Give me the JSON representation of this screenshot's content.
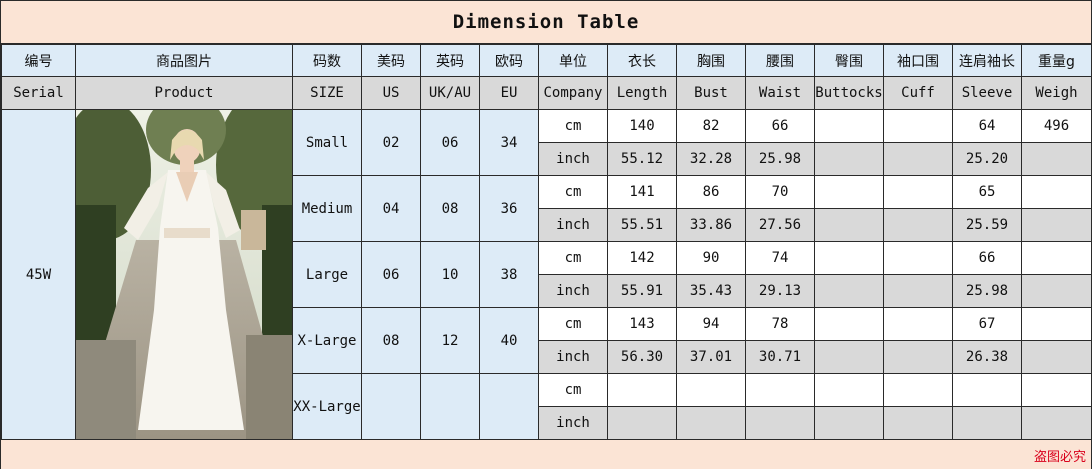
{
  "title": "Dimension Table",
  "header_cn": [
    "编号",
    "商品图片",
    "码数",
    "美码",
    "英码",
    "欧码",
    "单位",
    "衣长",
    "胸围",
    "腰围",
    "臀围",
    "袖口围",
    "连肩袖长",
    "重量g"
  ],
  "header_en": [
    "Serial",
    "Product",
    "SIZE",
    "US",
    "UK/AU",
    "EU",
    "Company",
    "Length",
    "Bust",
    "Waist",
    "Buttocks",
    "Cuff",
    "Sleeve",
    "Weigh"
  ],
  "serial": "45W",
  "product_image": "woman-in-white-long-sleeve-dress-photo",
  "sizes": [
    {
      "name": "Small",
      "us": "02",
      "uk": "06",
      "eu": "34",
      "cm": {
        "unit": "cm",
        "length": "140",
        "bust": "82",
        "waist": "66",
        "buttocks": "",
        "cuff": "",
        "sleeve": "64",
        "weight": "496"
      },
      "inch": {
        "unit": "inch",
        "length": "55.12",
        "bust": "32.28",
        "waist": "25.98",
        "buttocks": "",
        "cuff": "",
        "sleeve": "25.20",
        "weight": ""
      }
    },
    {
      "name": "Medium",
      "us": "04",
      "uk": "08",
      "eu": "36",
      "cm": {
        "unit": "cm",
        "length": "141",
        "bust": "86",
        "waist": "70",
        "buttocks": "",
        "cuff": "",
        "sleeve": "65",
        "weight": ""
      },
      "inch": {
        "unit": "inch",
        "length": "55.51",
        "bust": "33.86",
        "waist": "27.56",
        "buttocks": "",
        "cuff": "",
        "sleeve": "25.59",
        "weight": ""
      }
    },
    {
      "name": "Large",
      "us": "06",
      "uk": "10",
      "eu": "38",
      "cm": {
        "unit": "cm",
        "length": "142",
        "bust": "90",
        "waist": "74",
        "buttocks": "",
        "cuff": "",
        "sleeve": "66",
        "weight": ""
      },
      "inch": {
        "unit": "inch",
        "length": "55.91",
        "bust": "35.43",
        "waist": "29.13",
        "buttocks": "",
        "cuff": "",
        "sleeve": "25.98",
        "weight": ""
      }
    },
    {
      "name": "X-Large",
      "us": "08",
      "uk": "12",
      "eu": "40",
      "cm": {
        "unit": "cm",
        "length": "143",
        "bust": "94",
        "waist": "78",
        "buttocks": "",
        "cuff": "",
        "sleeve": "67",
        "weight": ""
      },
      "inch": {
        "unit": "inch",
        "length": "56.30",
        "bust": "37.01",
        "waist": "30.71",
        "buttocks": "",
        "cuff": "",
        "sleeve": "26.38",
        "weight": ""
      }
    },
    {
      "name": "XX-Large",
      "us": "",
      "uk": "",
      "eu": "",
      "cm": {
        "unit": "cm",
        "length": "",
        "bust": "",
        "waist": "",
        "buttocks": "",
        "cuff": "",
        "sleeve": "",
        "weight": ""
      },
      "inch": {
        "unit": "inch",
        "length": "",
        "bust": "",
        "waist": "",
        "buttocks": "",
        "cuff": "",
        "sleeve": "",
        "weight": ""
      }
    }
  ],
  "footer_note": "盗图必究",
  "colors": {
    "title_bg": "#fbe4d5",
    "header_bg": "#ddebf7",
    "grey_row": "#d9d9d9",
    "footer_text": "#d9001b"
  }
}
